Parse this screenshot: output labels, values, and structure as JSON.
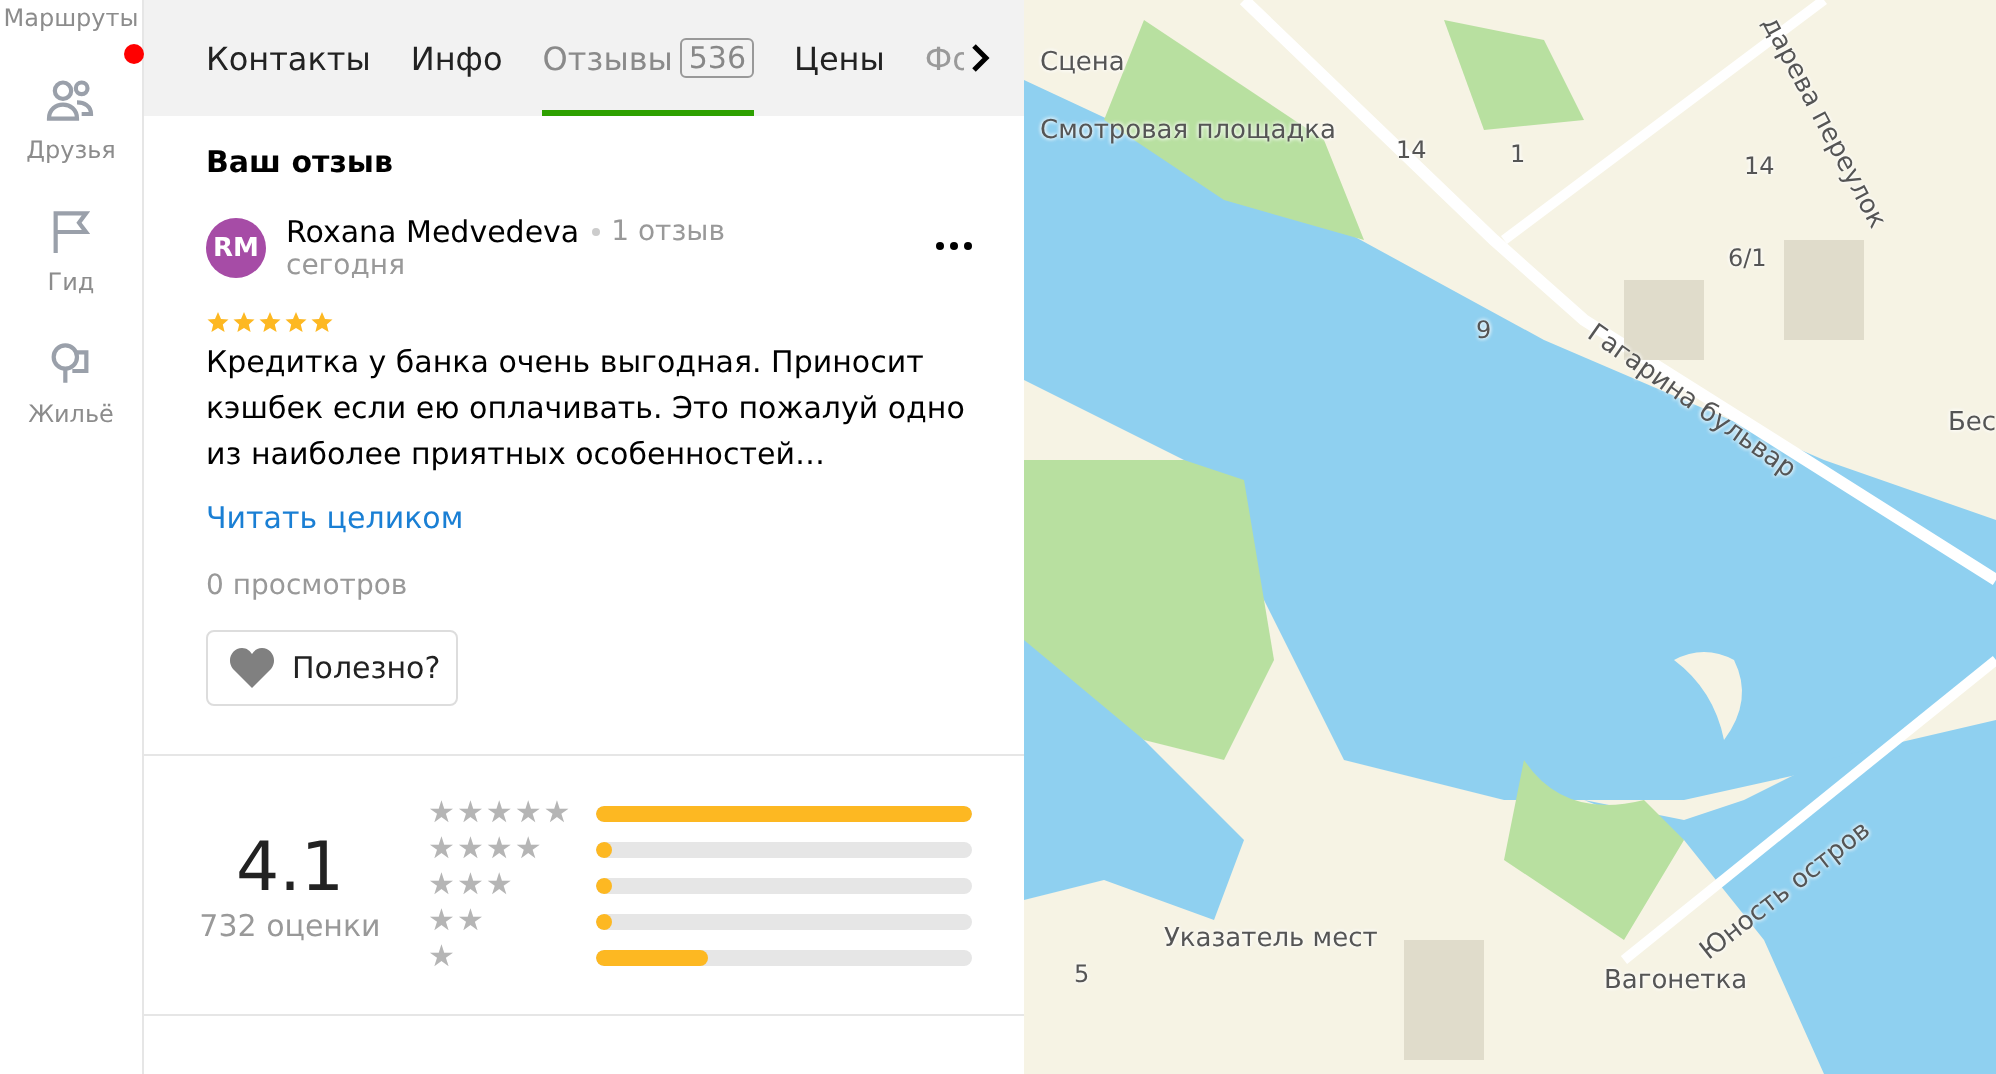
{
  "rail": [
    {
      "kind": "routes",
      "label": "Маршруты",
      "dot": false
    },
    {
      "kind": "friends",
      "label": "Друзья",
      "dot": true
    },
    {
      "kind": "guide",
      "label": "Гид",
      "dot": false
    },
    {
      "kind": "housing",
      "label": "Жильё",
      "dot": false
    }
  ],
  "tabs": [
    {
      "label": "Контакты",
      "selected": false
    },
    {
      "label": "Инфо",
      "selected": false
    },
    {
      "label": "Отзывы",
      "count": "536",
      "selected": true
    },
    {
      "label": "Цены",
      "selected": false
    },
    {
      "label": "Фо",
      "selected": false,
      "faded": true
    }
  ],
  "review": {
    "heading": "Ваш отзыв",
    "initials": "RM",
    "author": "Roxana Medvedeva",
    "author_reviews": "1 отзыв",
    "date": "сегодня",
    "stars": 5,
    "text": "Кредитка у банка очень выгодная. Приносит кэшбек если ею оплачивать. Это пожалуй одно из наиболее приятных особенностей…",
    "read_more": "Читать целиком",
    "views": "0 просмотров",
    "useful": "Полезно?"
  },
  "rating": {
    "score": "4.1",
    "count": "732 оценки",
    "bars": [
      {
        "label": "★★★★★",
        "level": 1.0
      },
      {
        "label": "★★★★",
        "level": 0.02
      },
      {
        "label": "★★★",
        "level": 0.02
      },
      {
        "label": "★★",
        "level": 0.02
      },
      {
        "label": "★",
        "level": 0.3
      }
    ]
  },
  "map": {
    "labels": [
      {
        "kind": "poi",
        "text": "Сцена"
      },
      {
        "kind": "poi",
        "text": "Смотровая площадка"
      },
      {
        "kind": "street",
        "text": "Гагарина бульвар"
      },
      {
        "kind": "street",
        "text": "дарева переулок"
      },
      {
        "kind": "street",
        "text": "Юность остров"
      },
      {
        "kind": "poi",
        "text": "Указатель мест"
      },
      {
        "kind": "poi",
        "text": "Вагонетка"
      },
      {
        "kind": "house",
        "text": "14"
      },
      {
        "kind": "house",
        "text": "1"
      },
      {
        "kind": "house",
        "text": "14"
      },
      {
        "kind": "house",
        "text": "6/1"
      },
      {
        "kind": "house",
        "text": "9"
      },
      {
        "kind": "house",
        "text": "5"
      },
      {
        "kind": "poi",
        "text": "Бес"
      }
    ]
  }
}
